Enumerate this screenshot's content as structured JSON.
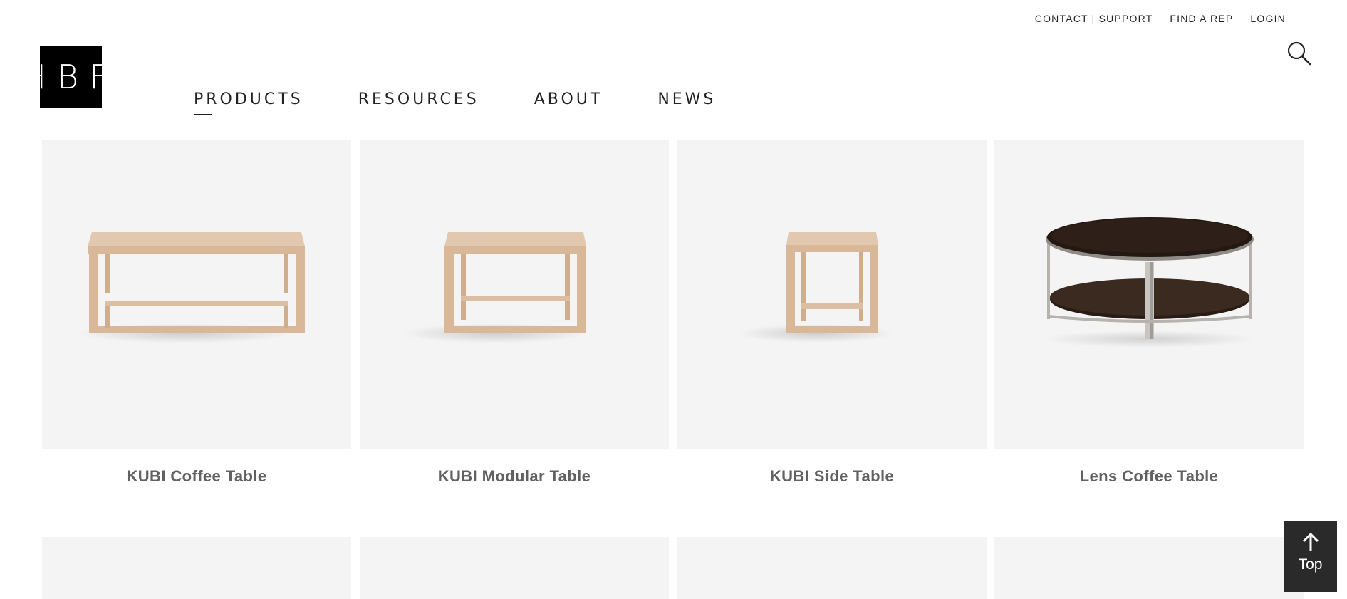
{
  "utility_nav": {
    "contact_support": "CONTACT | SUPPORT",
    "find_rep": "FIND A REP",
    "login": "LOGIN"
  },
  "logo": {
    "text": "HBF"
  },
  "main_nav": {
    "items": [
      {
        "label": "PRODUCTS",
        "active": true
      },
      {
        "label": "RESOURCES"
      },
      {
        "label": "ABOUT"
      },
      {
        "label": "NEWS"
      }
    ]
  },
  "products": [
    {
      "name": "KUBI Coffee Table",
      "image_icon": "kubi-coffee-table-image"
    },
    {
      "name": "KUBI Modular Table",
      "image_icon": "kubi-modular-table-image"
    },
    {
      "name": "KUBI Side Table",
      "image_icon": "kubi-side-table-image"
    },
    {
      "name": "Lens Coffee Table",
      "image_icon": "lens-coffee-table-image"
    }
  ],
  "back_to_top": {
    "label": "Top"
  },
  "icons": {
    "search": "search-icon",
    "back_to_top": "arrow-up-icon"
  },
  "colors": {
    "logo_bg": "#000000",
    "card_bg": "#f4f4f4",
    "product_name": "#616161",
    "top_button_bg": "#2a2a2a",
    "wood": "#dcbfa3",
    "dark_wood": "#2a1c14",
    "steel": "#b6b3ae"
  }
}
